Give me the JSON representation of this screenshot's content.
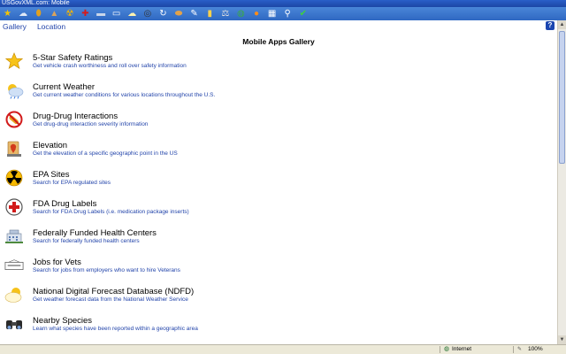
{
  "window": {
    "title": "USGovXML.com: Mobile"
  },
  "toolbar": {
    "buttons": [
      {
        "icon": "star-icon",
        "glyph": "★",
        "color": "#f5c400"
      },
      {
        "icon": "weather-icon",
        "glyph": "☁",
        "color": "#dfe9f7"
      },
      {
        "icon": "pill-icon",
        "glyph": "⬮",
        "color": "#e0a020"
      },
      {
        "icon": "elevation-icon",
        "glyph": "▲",
        "color": "#d9a35c"
      },
      {
        "icon": "radiation-icon",
        "glyph": "☢",
        "color": "#f2b400"
      },
      {
        "icon": "medical-cross-icon",
        "glyph": "✚",
        "color": "#d61b1b"
      },
      {
        "icon": "health-center-icon",
        "glyph": "▬",
        "color": "#c9d6ea"
      },
      {
        "icon": "jobs-icon",
        "glyph": "▭",
        "color": "#ffffff"
      },
      {
        "icon": "forecast-icon",
        "glyph": "☁",
        "color": "#fff3b0"
      },
      {
        "icon": "binoculars-icon",
        "glyph": "◎",
        "color": "#333333"
      },
      {
        "icon": "refresh-icon",
        "glyph": "↻",
        "color": "#ffffff"
      },
      {
        "icon": "bread-icon",
        "glyph": "⬬",
        "color": "#e2a24a"
      },
      {
        "icon": "pen-icon",
        "glyph": "✎",
        "color": "#ffffff"
      },
      {
        "icon": "book-icon",
        "glyph": "▮",
        "color": "#ffd24a"
      },
      {
        "icon": "scales-icon",
        "glyph": "⚖",
        "color": "#e0e0e0"
      },
      {
        "icon": "globe-icon",
        "glyph": "◍",
        "color": "#3aa84a"
      },
      {
        "icon": "sun-icon",
        "glyph": "●",
        "color": "#ff8c1a"
      },
      {
        "icon": "grid-icon",
        "glyph": "▦",
        "color": "#ffffff"
      },
      {
        "icon": "magnifier-icon",
        "glyph": "⚲",
        "color": "#ffffff"
      },
      {
        "icon": "checkmark-icon",
        "glyph": "✔",
        "color": "#3ecf3e"
      }
    ]
  },
  "nav": {
    "links": [
      "Gallery",
      "Location"
    ],
    "help": "?"
  },
  "page": {
    "title": "Mobile Apps Gallery"
  },
  "apps": [
    {
      "title": "5-Star Safety Ratings",
      "desc": "Get vehicle crash worthiness and roll over safety information",
      "icon": "star-icon"
    },
    {
      "title": "Current Weather",
      "desc": "Get current weather conditions for various locations throughout the U.S.",
      "icon": "weather-icon"
    },
    {
      "title": "Drug-Drug Interactions",
      "desc": "Get drug-drug interaction severity information",
      "icon": "pill-icon"
    },
    {
      "title": "Elevation",
      "desc": "Get the elevation of a specific geographic point in the US",
      "icon": "elevation-icon"
    },
    {
      "title": "EPA Sites",
      "desc": "Search for EPA regulated sites",
      "icon": "radiation-icon"
    },
    {
      "title": "FDA Drug Labels",
      "desc": "Search for FDA Drug Labels (i.e. medication package inserts)",
      "icon": "medical-cross-icon"
    },
    {
      "title": "Federally Funded Health Centers",
      "desc": "Search for federally funded health centers",
      "icon": "health-center-icon"
    },
    {
      "title": "Jobs for Vets",
      "desc": "Search for jobs from employers who want to hire Veterans",
      "icon": "jobs-icon"
    },
    {
      "title": "National Digital Forecast Database (NDFD)",
      "desc": "Get weather forecast data from the National Weather Service",
      "icon": "forecast-icon"
    },
    {
      "title": "Nearby Species",
      "desc": "Learn what species have been reported within a geographic area",
      "icon": "binoculars-icon"
    }
  ],
  "status": {
    "zone": "Internet",
    "zoom": "100%"
  }
}
